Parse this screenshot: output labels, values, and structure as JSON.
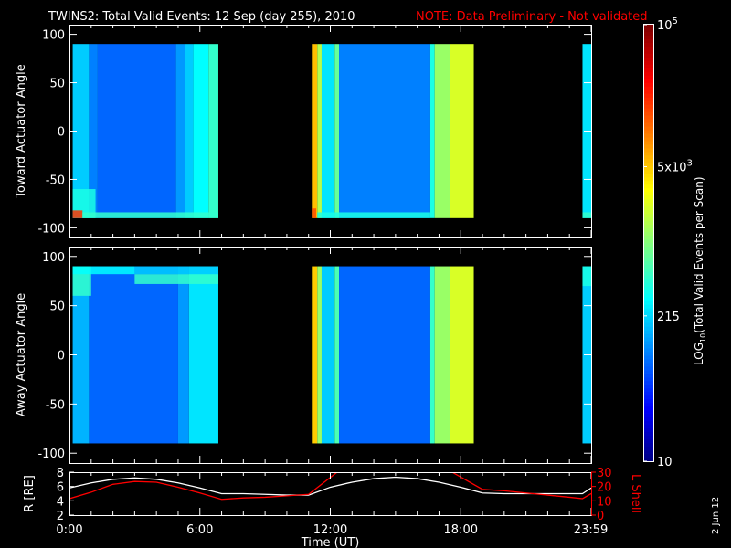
{
  "title": {
    "main": "TWINS2: Total Valid Events: 12 Sep (day 255), 2010",
    "note": "NOTE: Data Preliminary - Not validated",
    "note_color": "#ff0000"
  },
  "side_stamp": "2 Jun 12",
  "chart_data": [
    {
      "type": "heatmap",
      "name": "toward",
      "ylabel": "Toward Actuator Angle",
      "ylim": [
        -110,
        110
      ],
      "yticks": [
        "100",
        "50",
        "0",
        "-50",
        "-100"
      ],
      "ytick_values": [
        100,
        50,
        0,
        -50,
        -100
      ],
      "angle_range": [
        -90,
        90
      ],
      "xlim_hours": [
        0,
        24
      ],
      "bands": [
        [
          0.15,
          0.9,
          2.3
        ],
        [
          0.9,
          1.3,
          2.0
        ],
        [
          1.3,
          4.9,
          1.9
        ],
        [
          4.9,
          5.3,
          2.1
        ],
        [
          5.3,
          5.7,
          2.3
        ],
        [
          5.7,
          6.4,
          2.5
        ],
        [
          6.4,
          6.85,
          2.7
        ],
        [
          11.15,
          11.4,
          3.75
        ],
        [
          11.4,
          11.6,
          3.2
        ],
        [
          11.6,
          12.2,
          2.4
        ],
        [
          12.2,
          12.4,
          2.9
        ],
        [
          12.4,
          16.6,
          2.0
        ],
        [
          16.6,
          16.8,
          2.6
        ],
        [
          16.8,
          17.5,
          3.1
        ],
        [
          17.5,
          18.6,
          3.35
        ],
        [
          23.6,
          24.0,
          2.4
        ]
      ],
      "patches": [
        [
          0.15,
          1.2,
          -90,
          -60,
          2.6
        ],
        [
          0.15,
          0.6,
          -90,
          -82,
          4.3
        ],
        [
          0.6,
          6.85,
          -90,
          -84,
          2.7
        ],
        [
          11.15,
          11.35,
          -90,
          -80,
          4.2
        ],
        [
          11.4,
          16.6,
          -90,
          -84,
          2.6
        ],
        [
          23.6,
          24.0,
          -90,
          -84,
          2.7
        ]
      ]
    },
    {
      "type": "heatmap",
      "name": "away",
      "ylabel": "Away Actuator Angle",
      "ylim": [
        -110,
        110
      ],
      "yticks": [
        "100",
        "50",
        "0",
        "-50",
        "-100"
      ],
      "ytick_values": [
        100,
        50,
        0,
        -50,
        -100
      ],
      "angle_range": [
        -90,
        90
      ],
      "xlim_hours": [
        0,
        24
      ],
      "bands": [
        [
          0.15,
          0.9,
          2.2
        ],
        [
          0.9,
          5.0,
          1.9
        ],
        [
          5.0,
          5.5,
          2.1
        ],
        [
          5.5,
          6.85,
          2.4
        ],
        [
          11.15,
          11.4,
          3.7
        ],
        [
          11.4,
          11.6,
          3.1
        ],
        [
          11.6,
          12.2,
          2.3
        ],
        [
          12.2,
          12.4,
          2.8
        ],
        [
          12.4,
          16.6,
          1.9
        ],
        [
          16.6,
          16.8,
          2.7
        ],
        [
          16.8,
          17.5,
          3.1
        ],
        [
          17.5,
          18.6,
          3.35
        ],
        [
          23.6,
          24.0,
          2.3
        ]
      ],
      "patches": [
        [
          0.15,
          1.0,
          60,
          90,
          2.7
        ],
        [
          0.15,
          3.0,
          82,
          90,
          2.5
        ],
        [
          3.0,
          6.85,
          72,
          82,
          2.7
        ],
        [
          3.0,
          6.85,
          82,
          90,
          2.3
        ],
        [
          23.6,
          24.0,
          70,
          90,
          2.6
        ]
      ]
    },
    {
      "type": "line",
      "name": "ephemeris",
      "ylabel": "R [RE]",
      "y2label": "L Shell",
      "y2color": "#ff0000",
      "ylim": [
        2,
        8
      ],
      "y2lim": [
        0,
        30
      ],
      "yticks": [
        "8",
        "6",
        "4",
        "2"
      ],
      "ytick_values": [
        8,
        6,
        4,
        2
      ],
      "y2ticks": [
        "30",
        "20",
        "10",
        "0"
      ],
      "y2tick_values": [
        30,
        20,
        10,
        0
      ],
      "xlabel": "Time (UT)",
      "xticks": [
        "0:00",
        "6:00",
        "12:00",
        "18:00",
        "23:59"
      ],
      "xtick_hours": [
        0,
        6,
        12,
        18,
        23.98
      ],
      "series": [
        {
          "name": "R",
          "axis": "left",
          "color": "#ffffff",
          "x": [
            0,
            1,
            2,
            3,
            4,
            5,
            6,
            7,
            8,
            9,
            10,
            11,
            12,
            13,
            14,
            15,
            16,
            17,
            18,
            19,
            20,
            21,
            22,
            23,
            23.6,
            24
          ],
          "y": [
            5.8,
            6.5,
            7.0,
            7.2,
            7.0,
            6.5,
            5.8,
            5.0,
            5.0,
            4.9,
            4.8,
            4.8,
            5.9,
            6.6,
            7.1,
            7.3,
            7.1,
            6.6,
            5.9,
            5.1,
            5.0,
            5.0,
            5.0,
            5.0,
            5.0,
            5.8
          ]
        },
        {
          "name": "L Shell",
          "axis": "right",
          "color": "#ff0000",
          "x": [
            0,
            1,
            2,
            3,
            4,
            5,
            6,
            7,
            8,
            9,
            10,
            11,
            12.4,
            12.6
          ],
          "y": [
            11.5,
            16,
            21.5,
            23.5,
            23,
            19.5,
            15.5,
            11,
            12,
            12.5,
            13.5,
            14.5,
            31,
            34
          ]
        },
        {
          "name": "L Shell (2)",
          "axis": "right",
          "color": "#ff0000",
          "x": [
            17.2,
            17.6,
            18.3,
            19.0,
            20,
            21,
            22,
            23,
            23.6,
            24
          ],
          "y": [
            34,
            30,
            24,
            18,
            17,
            15.5,
            14,
            12.5,
            11.5,
            15
          ]
        }
      ]
    }
  ],
  "colorbar": {
    "label": "LOG10(Total Valid Events per Scan)",
    "label_prefix": "LOG",
    "label_sub": "10",
    "label_rest": "(Total Valid Events per Scan)",
    "range_log": [
      1,
      5
    ],
    "ticks": [
      {
        "base": "10",
        "exp": "5",
        "log": 5
      },
      {
        "base": "5x10",
        "exp": "3",
        "log": 3.699
      },
      {
        "base": "215",
        "exp": "",
        "log": 2.332
      },
      {
        "base": "10",
        "exp": "",
        "log": 1
      }
    ]
  }
}
